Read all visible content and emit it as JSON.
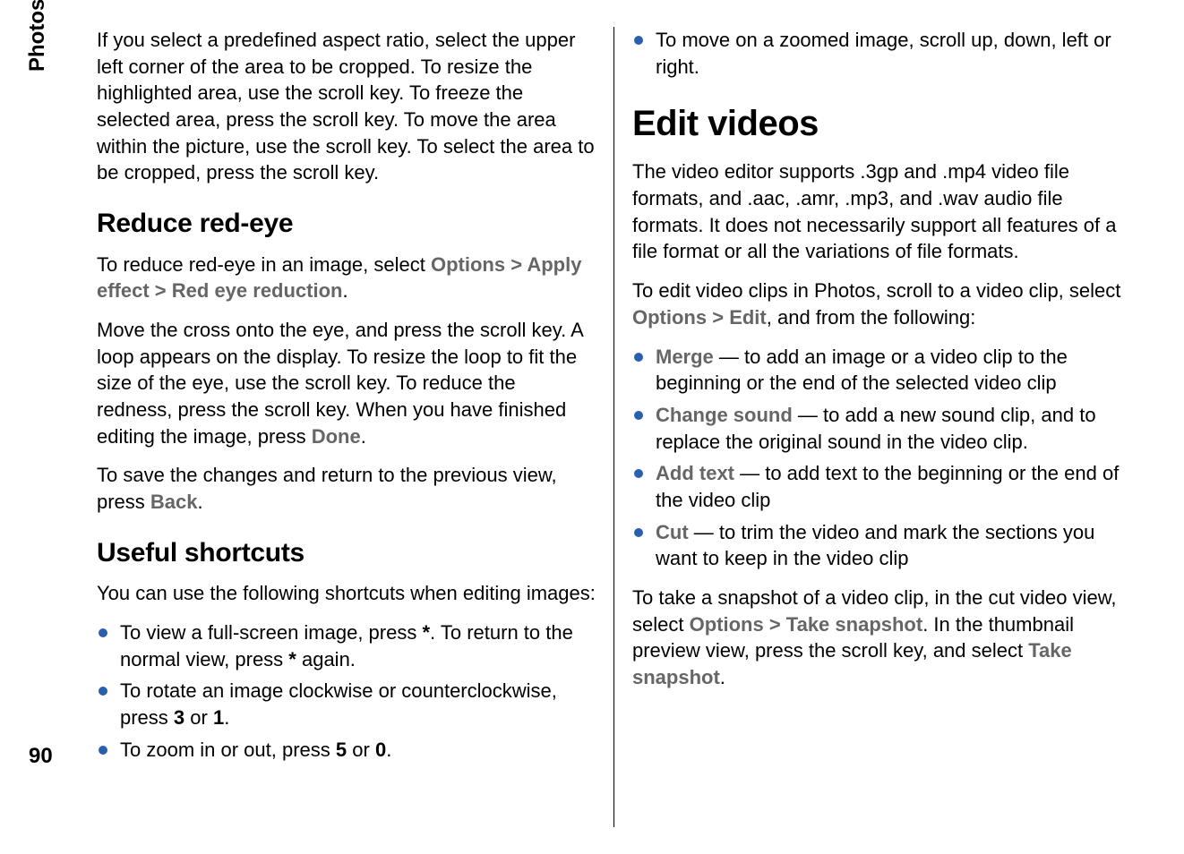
{
  "side_label": "Photos",
  "page_number": "90",
  "left": {
    "intro": "If you select a predefined aspect ratio, select the upper left corner of the area to be cropped. To resize the highlighted area, use the scroll key. To freeze the selected area, press the scroll key. To move the area within the picture, use the scroll key. To select the area to be cropped, press the scroll key.",
    "h2_redeye": "Reduce red-eye",
    "redeye_p1_a": "To reduce red-eye in an image, select ",
    "redeye_p1_opt": "Options",
    "redeye_p1_gt1": " > ",
    "redeye_p1_apply": "Apply effect",
    "redeye_p1_gt2": " > ",
    "redeye_p1_red": "Red eye reduction",
    "redeye_p1_end": ".",
    "redeye_p2_a": "Move the cross onto the eye, and press the scroll key. A loop appears on the display. To resize the loop to fit the size of the eye, use the scroll key. To reduce the redness, press the scroll key. When you have finished editing the image, press ",
    "redeye_p2_done": "Done",
    "redeye_p2_end": ".",
    "redeye_p3_a": "To save the changes and return to the previous view, press ",
    "redeye_p3_back": "Back",
    "redeye_p3_end": ".",
    "h2_shortcuts": "Useful shortcuts",
    "shortcuts_intro": "You can use the following shortcuts when editing images:",
    "sc1_a": "To view a full-screen image, press ",
    "sc1_star": "*",
    "sc1_b": ". To return to the normal view, press ",
    "sc1_star2": "*",
    "sc1_c": " again.",
    "sc2_a": "To rotate an image clockwise or counterclockwise, press ",
    "sc2_3": "3",
    "sc2_b": " or ",
    "sc2_1": "1",
    "sc2_c": ".",
    "sc3_a": "To zoom in or out, press ",
    "sc3_5": "5",
    "sc3_b": " or ",
    "sc3_0": "0",
    "sc3_c": "."
  },
  "right": {
    "sc4": "To move on a zoomed image, scroll up, down, left or right.",
    "h1_edit": "Edit videos",
    "ev_p1": "The video editor supports .3gp and .mp4 video file formats, and .aac, .amr, .mp3, and .wav audio file formats. It does not necessarily support all features of a file format or all the variations of file formats.",
    "ev_p2_a": "To edit video clips in Photos, scroll to a video clip, select ",
    "ev_p2_opt": "Options",
    "ev_p2_gt": " > ",
    "ev_p2_edit": "Edit",
    "ev_p2_b": ", and from the following:",
    "li_merge_k": "Merge",
    "li_merge_t": " — to add an image or a video clip to the beginning or the end of the selected video clip",
    "li_cs_k": "Change sound",
    "li_cs_t": " — to add a new sound clip, and to replace the original sound in the video clip.",
    "li_at_k": "Add text",
    "li_at_t": " — to add text to the beginning or the end of the video clip",
    "li_cut_k": "Cut",
    "li_cut_t": " — to trim the video and mark the sections you want to keep in the video clip",
    "ev_p3_a": "To take a snapshot of a video clip, in the cut video view, select ",
    "ev_p3_opt": "Options",
    "ev_p3_gt": " > ",
    "ev_p3_take": "Take snapshot",
    "ev_p3_b": ". In the thumbnail preview view, press the scroll key, and select ",
    "ev_p3_take2": "Take snapshot",
    "ev_p3_c": "."
  }
}
